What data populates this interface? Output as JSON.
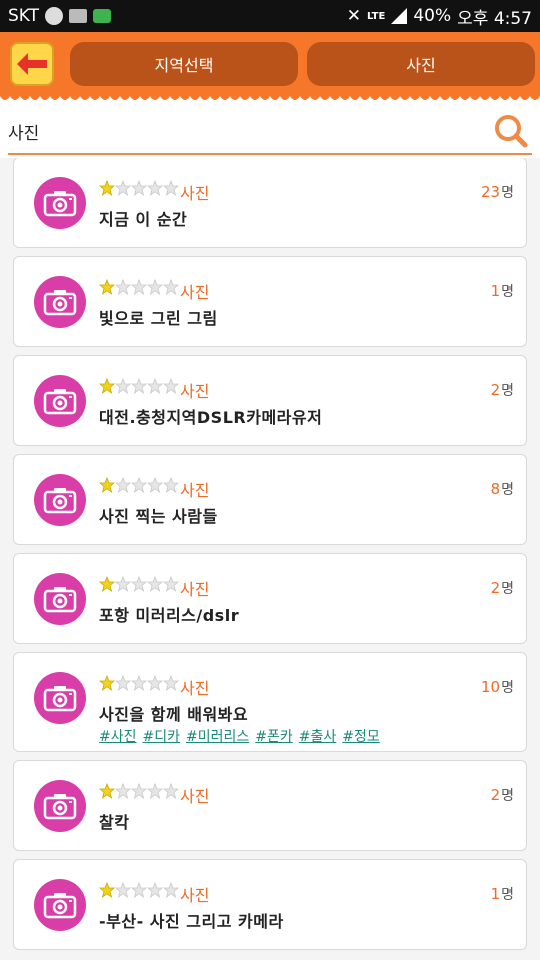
{
  "status_bar": {
    "carrier": "SKT",
    "network": "LTE",
    "battery": "40%",
    "time": "오후 4:57"
  },
  "header": {
    "region_button": "지역선택",
    "category_button": "사진"
  },
  "search": {
    "value": "사진"
  },
  "clubs": [
    {
      "title": "",
      "category": "",
      "count": "",
      "unit": ""
    },
    {
      "title": "지금 이 순간",
      "category": "사진",
      "count": "23",
      "unit": "명",
      "stars": 1
    },
    {
      "title": "빛으로 그린 그림",
      "category": "사진",
      "count": "1",
      "unit": "명",
      "stars": 1
    },
    {
      "title": "대전.충청지역DSLR카메라유저",
      "category": "사진",
      "count": "2",
      "unit": "명",
      "stars": 1
    },
    {
      "title": "사진 찍는 사람들",
      "category": "사진",
      "count": "8",
      "unit": "명",
      "stars": 1
    },
    {
      "title": "포항 미러리스/dslr",
      "category": "사진",
      "count": "2",
      "unit": "명",
      "stars": 1
    },
    {
      "title": "사진을 함께 배워봐요",
      "category": "사진",
      "count": "10",
      "unit": "명",
      "stars": 1,
      "tags": [
        "#사진",
        "#디카",
        "#미러리스",
        "#폰카",
        "#출사",
        "#정모"
      ]
    },
    {
      "title": "찰칵",
      "category": "사진",
      "count": "2",
      "unit": "명",
      "stars": 1
    },
    {
      "title": "-부산- 사진 그리고 카메라",
      "category": "사진",
      "count": "1",
      "unit": "명",
      "stars": 1
    }
  ],
  "colors": {
    "header": "#f6762a",
    "accent": "#f06a24",
    "avatar": "#d83da8",
    "tag": "#1a8a7a"
  }
}
